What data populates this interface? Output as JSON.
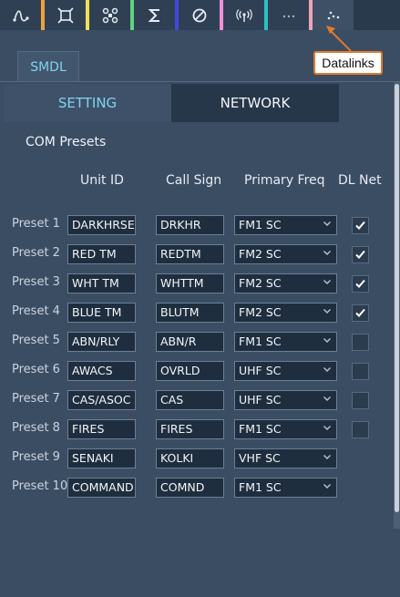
{
  "toolbar": {
    "buttons": [
      {
        "icon": "route-icon",
        "stripe": "#f0a23a"
      },
      {
        "icon": "target-icon",
        "stripe": "#f4e04a"
      },
      {
        "icon": "drone-icon",
        "stripe": "#5fd37a"
      },
      {
        "icon": "sigma-icon",
        "stripe": "#3f4ad8"
      },
      {
        "icon": "prohibit-icon",
        "stripe": "#f08fd8"
      },
      {
        "icon": "antenna-icon",
        "stripe": "#2fc1c1"
      },
      {
        "icon": "more-icon",
        "stripe": "#f2a0b4"
      }
    ],
    "active": {
      "icon": "datalinks-icon"
    }
  },
  "callout": {
    "label": "Datalinks",
    "border_color": "#e07a2e"
  },
  "tabs": {
    "smdl": "SMDL"
  },
  "subtabs": {
    "setting": "SETTING",
    "network": "NETWORK"
  },
  "com_presets": {
    "title": "COM Presets",
    "headers": {
      "unit_id": "Unit ID",
      "call_sign": "Call Sign",
      "primary_freq": "Primary Freq",
      "dl_net": "DL Net"
    },
    "rows": [
      {
        "label": "Preset 1",
        "unit_id": "DARKHRSE",
        "call_sign": "DRKHR",
        "freq": "FM1 SC",
        "dl_net": true
      },
      {
        "label": "Preset 2",
        "unit_id": "RED TM",
        "call_sign": "REDTM",
        "freq": "FM2 SC",
        "dl_net": true
      },
      {
        "label": "Preset 3",
        "unit_id": "WHT TM",
        "call_sign": "WHTTM",
        "freq": "FM2 SC",
        "dl_net": true
      },
      {
        "label": "Preset 4",
        "unit_id": "BLUE TM",
        "call_sign": "BLUTM",
        "freq": "FM2 SC",
        "dl_net": true
      },
      {
        "label": "Preset 5",
        "unit_id": "ABN/RLY",
        "call_sign": "ABN/R",
        "freq": "FM1 SC",
        "dl_net": false
      },
      {
        "label": "Preset 6",
        "unit_id": "AWACS",
        "call_sign": "OVRLD",
        "freq": "UHF SC",
        "dl_net": false
      },
      {
        "label": "Preset 7",
        "unit_id": "CAS/ASOC",
        "call_sign": "CAS",
        "freq": "UHF SC",
        "dl_net": false
      },
      {
        "label": "Preset 8",
        "unit_id": "FIRES",
        "call_sign": "FIRES",
        "freq": "FM1 SC",
        "dl_net": false
      },
      {
        "label": "Preset 9",
        "unit_id": "SENAKI",
        "call_sign": "KOLKI",
        "freq": "VHF SC",
        "dl_net": null
      },
      {
        "label": "Preset 10",
        "unit_id": "COMMAND",
        "call_sign": "COMND",
        "freq": "FM1 SC",
        "dl_net": null
      }
    ]
  }
}
